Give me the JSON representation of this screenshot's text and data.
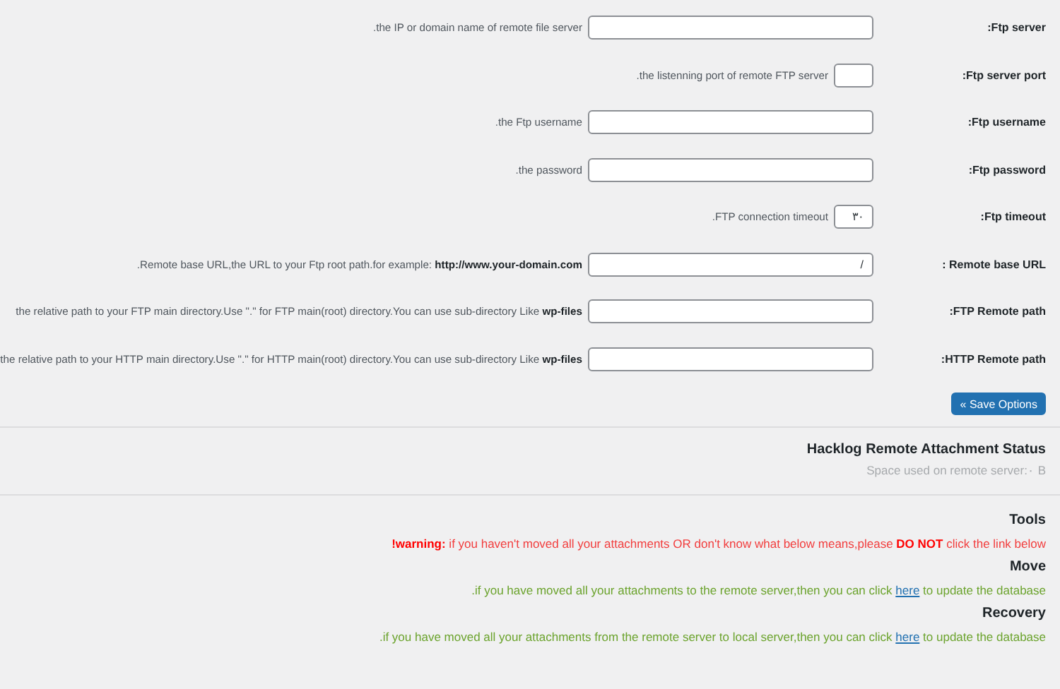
{
  "fields": [
    {
      "label": ":Ftp server",
      "kind": "text",
      "description": ".the IP or domain name of remote file server"
    },
    {
      "label": ":Ftp server port",
      "kind": "short",
      "description": ".the listenning port of remote FTP server"
    },
    {
      "label": ":Ftp username",
      "kind": "text",
      "description": ".the Ftp username"
    },
    {
      "label": ":Ftp password",
      "kind": "text",
      "description": ".the password"
    },
    {
      "label": ":Ftp timeout",
      "kind": "short",
      "value": "۳۰",
      "description": ".FTP connection timeout"
    },
    {
      "label": ": Remote base URL",
      "kind": "text",
      "value": "/",
      "description": ".Remote base URL,the URL to your Ftp root path.for example: **http://www.your-domain.com**"
    },
    {
      "label": ":FTP Remote path",
      "kind": "text",
      "description": "the relative path to your FTP main directory.Use \".\" for FTP main(root) directory.You can use sub-directory Like **wp-files**"
    },
    {
      "label": ":HTTP Remote path",
      "kind": "text",
      "description": "the relative path to your HTTP main directory.Use \".\" for HTTP main(root) directory.You can use sub-directory Like **wp-files**"
    }
  ],
  "save_button": "« Save Options",
  "status": {
    "title": "Hacklog Remote Attachment Status",
    "space_used": "Space used on remote server:۰ B"
  },
  "tools": {
    "title": "Tools",
    "warning": "**!warning:** if you haven't moved all your attachments OR don't know what below means,please **DO NOT** click the link below",
    "sections": [
      {
        "title": "Move",
        "before": ".if you have moved all your attachments to the remote server,then you can click",
        "link": "here",
        "after": "to update the database"
      },
      {
        "title": "Recovery",
        "before": ".if you have moved all your attachments from the remote server to local server,then you can click",
        "link": "here",
        "after": "to update the database"
      }
    ]
  }
}
